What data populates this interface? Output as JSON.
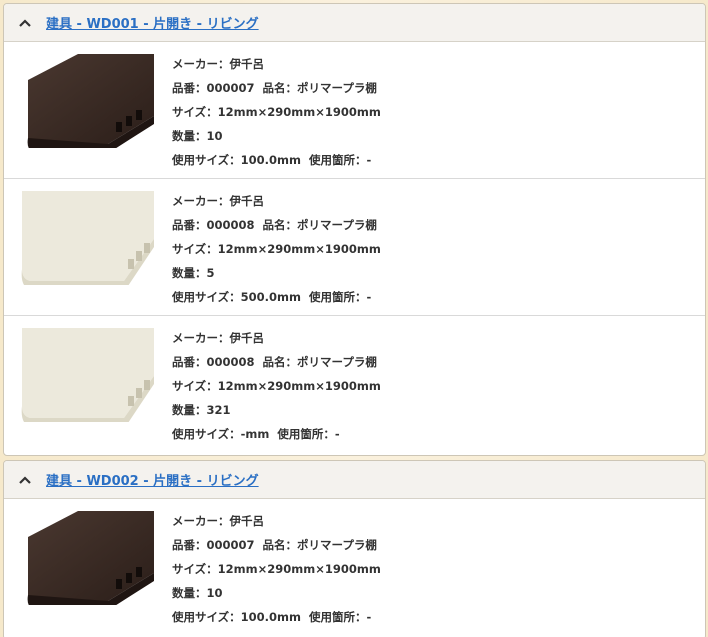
{
  "sections": [
    {
      "title": "建具 - WD001 - 片開き - リビング",
      "items": [
        {
          "maker": "メーカー：伊千呂",
          "code": "品番：000007",
          "name": "品名：ポリマープラ棚",
          "size": "サイズ：12mm×290mm×1900mm",
          "qty": "数量：10",
          "usage_size": "使用サイズ：100.0mm",
          "usage_place": "使用箇所：-",
          "thumb": "dark"
        },
        {
          "maker": "メーカー：伊千呂",
          "code": "品番：000008",
          "name": "品名：ポリマープラ棚",
          "size": "サイズ：12mm×290mm×1900mm",
          "qty": "数量：5",
          "usage_size": "使用サイズ：500.0mm",
          "usage_place": "使用箇所：-",
          "thumb": "light"
        },
        {
          "maker": "メーカー：伊千呂",
          "code": "品番：000008",
          "name": "品名：ポリマープラ棚",
          "size": "サイズ：12mm×290mm×1900mm",
          "qty": "数量：321",
          "usage_size": "使用サイズ：-mm",
          "usage_place": "使用箇所：-",
          "thumb": "light"
        }
      ]
    },
    {
      "title": "建具 - WD002 - 片開き - リビング",
      "items": [
        {
          "maker": "メーカー：伊千呂",
          "code": "品番：000007",
          "name": "品名：ポリマープラ棚",
          "size": "サイズ：12mm×290mm×1900mm",
          "qty": "数量：10",
          "usage_size": "使用サイズ：100.0mm",
          "usage_place": "使用箇所：-",
          "thumb": "dark"
        }
      ]
    }
  ],
  "colors": {
    "link": "#2a6fc4",
    "dark_board": "#3a2a24",
    "light_board": "#ece9dc"
  },
  "icons": {
    "collapse": "chevron-up-icon"
  }
}
